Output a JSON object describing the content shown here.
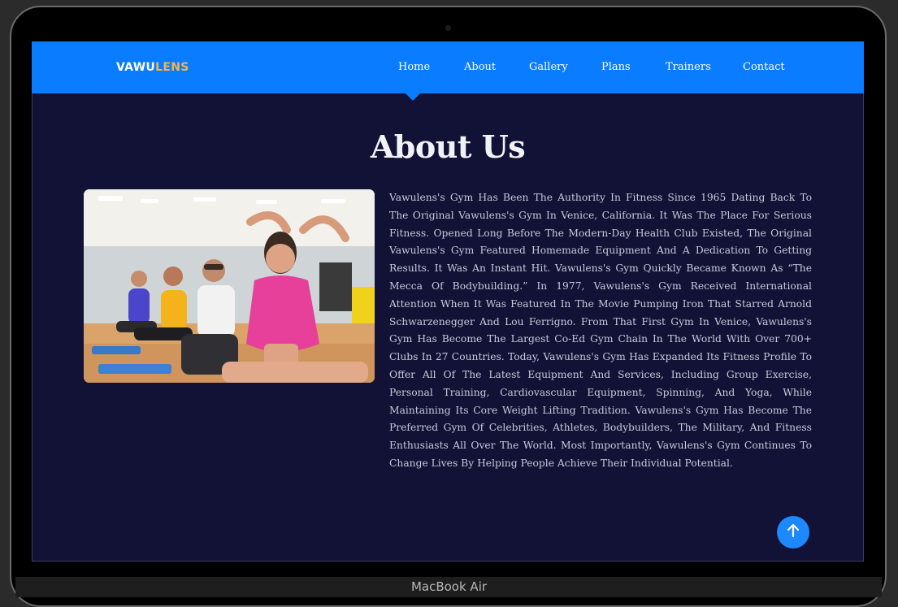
{
  "site": {
    "logo_part1": "VAWU",
    "logo_part2": "LENS",
    "accent_color": "#0a7cff",
    "logo_accent_color": "#f4b544",
    "background_color": "#111235"
  },
  "nav": {
    "items": [
      {
        "label": "Home",
        "active": true
      },
      {
        "label": "About",
        "active": false
      },
      {
        "label": "Gallery",
        "active": false
      },
      {
        "label": "Plans",
        "active": false
      },
      {
        "label": "Trainers",
        "active": false
      },
      {
        "label": "Contact",
        "active": false
      }
    ]
  },
  "about": {
    "title": "About Us",
    "photo_icon": "fitness-class-photo",
    "body": "Vawulens's Gym Has Been The Authority In Fitness Since 1965 Dating Back To The Original Vawulens's Gym In Venice, California. It Was The Place For Serious Fitness. Opened Long Before The Modern-Day Health Club Existed, The Original Vawulens's Gym Featured Homemade Equipment And A Dedication To Getting Results. It Was An Instant Hit. Vawulens's Gym Quickly Became Known As “The Mecca Of Bodybuilding.” In 1977, Vawulens's Gym Received International Attention When It Was Featured In The Movie Pumping Iron That Starred Arnold Schwarzenegger And Lou Ferrigno. From That First Gym In Venice, Vawulens's Gym Has Become The Largest Co-Ed Gym Chain In The World With Over 700+ Clubs In 27 Countries. Today, Vawulens's Gym Has Expanded Its Fitness Profile To Offer All Of The Latest Equipment And Services, Including Group Exercise, Personal Training, Cardiovascular Equipment, Spinning, And Yoga, While Maintaining Its Core Weight Lifting Tradition. Vawulens's Gym Has Become The Preferred Gym Of Celebrities, Athletes, Bodybuilders, The Military, And Fitness Enthusiasts All Over The World. Most Importantly, Vawulens's Gym Continues To Change Lives By Helping People Achieve Their Individual Potential."
  },
  "scroll_top": {
    "icon": "arrow-up-icon"
  },
  "device": {
    "label": "MacBook Air"
  }
}
